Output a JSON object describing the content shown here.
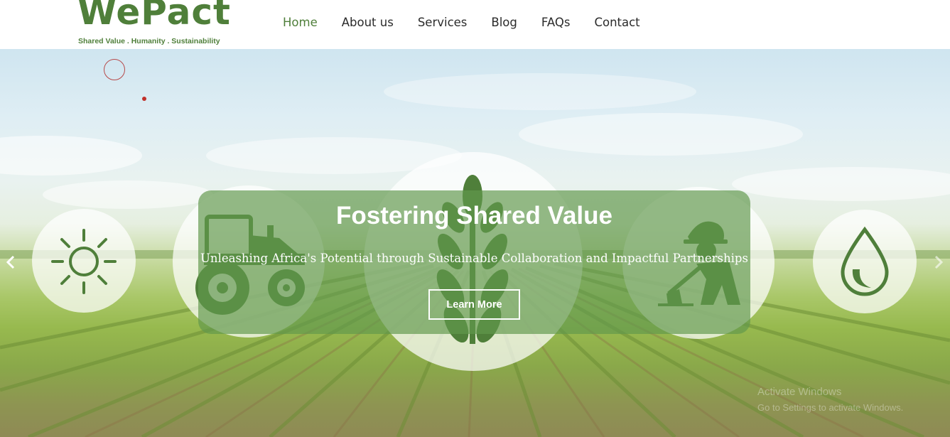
{
  "brand": {
    "name": "WePact",
    "tagline": "Shared Value . Humanity . Sustainability",
    "color": "#4f7f3a"
  },
  "nav": {
    "items": [
      {
        "label": "Home",
        "active": true
      },
      {
        "label": "About us",
        "active": false
      },
      {
        "label": "Services",
        "active": false
      },
      {
        "label": "Blog",
        "active": false
      },
      {
        "label": "FAQs",
        "active": false
      },
      {
        "label": "Contact",
        "active": false
      }
    ]
  },
  "hero": {
    "title": "Fostering Shared Value",
    "subtitle": "Unleashing Africa's Potential through Sustainable Collaboration and Impactful Partnerships",
    "cta_label": "Learn More",
    "icons": [
      "sun-icon",
      "tractor-icon",
      "wheat-icon",
      "farmer-icon",
      "water-drop-icon"
    ],
    "prev_icon": "chevron-left-icon",
    "next_icon": "chevron-right-icon"
  },
  "watermark": {
    "line1": "Activate Windows",
    "line2": "Go to Settings to activate Windows."
  }
}
